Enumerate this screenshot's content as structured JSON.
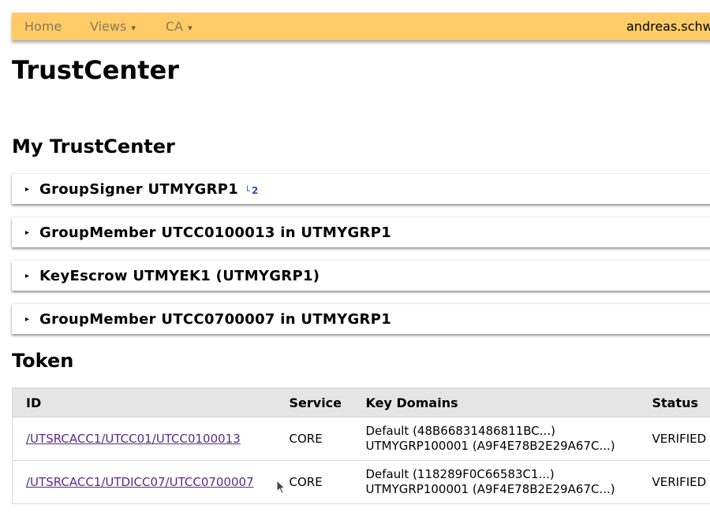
{
  "nav": {
    "home": "Home",
    "views": "Views",
    "ca": "CA",
    "caret": "▾",
    "user": "andreas.schw"
  },
  "page_title": "TrustCenter",
  "section_my": "My TrustCenter",
  "panels": [
    {
      "title": "GroupSigner UTMYGRP1",
      "badge_hook": "└",
      "badge_count": "2"
    },
    {
      "title": "GroupMember UTCC0100013 in UTMYGRP1"
    },
    {
      "title": "KeyEscrow UTMYEK1 (UTMYGRP1)"
    },
    {
      "title": "GroupMember UTCC0700007 in UTMYGRP1"
    }
  ],
  "panel_toggle_glyph": "▸",
  "section_token": "Token",
  "token_table": {
    "headers": [
      "ID",
      "Service",
      "Key Domains",
      "Status"
    ],
    "rows": [
      {
        "id": "/UTSRCACC1/UTCC01/UTCC0100013",
        "service": "CORE",
        "key_domains": [
          "Default (48B66831486811BC...)",
          "UTMYGRP100001 (A9F4E78B2E29A67C...)"
        ],
        "status": "VERIFIED"
      },
      {
        "id": "/UTSRCACC1/UTDICC07/UTCC0700007",
        "service": "CORE",
        "key_domains": [
          "Default (118289F0C66583C1...)",
          "UTMYGRP100001 (A9F4E78B2E29A67C...)"
        ],
        "status": "VERIFIED"
      }
    ]
  },
  "colors": {
    "navbar": "#ffcb66",
    "link": "#5b2a86",
    "badge": "#1f4fbf",
    "table_header": "#e5e5e5"
  },
  "icons": {
    "dropdown": "chevron-down-icon",
    "panel_toggle": "triangle-right-icon",
    "pointer": "mouse-cursor-icon"
  }
}
